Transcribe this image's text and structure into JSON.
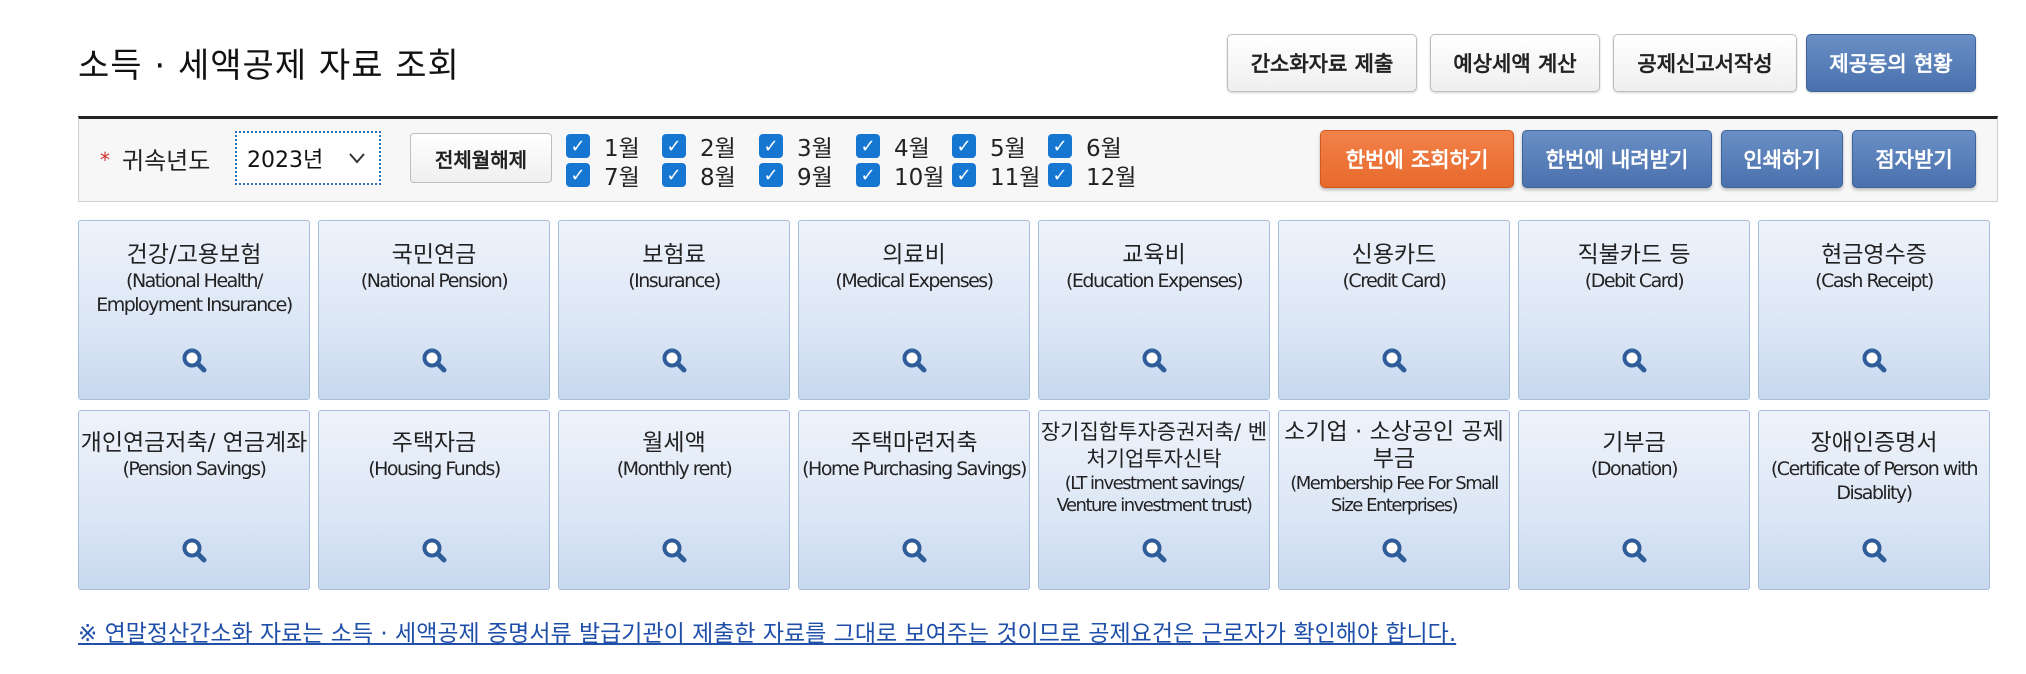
{
  "page": {
    "title": "소득 · 세액공제 자료 조회",
    "notice": "※ 연말정산간소화 자료는 소득 · 세액공제 증명서류 발급기관이 제출한 자료를 그대로 보여주는 것이므로 공제요건은 근로자가 확인해야 합니다."
  },
  "top_buttons": [
    {
      "label": "간소화자료 제출"
    },
    {
      "label": "예상세액 계산"
    },
    {
      "label": "공제신고서작성"
    },
    {
      "label": "제공동의 현황"
    }
  ],
  "search": {
    "required_mark": "*",
    "year_label": "귀속년도",
    "year_value": "2023년",
    "clear_months_label": "전체월해제",
    "months": [
      {
        "label": "1월",
        "checked": true
      },
      {
        "label": "2월",
        "checked": true
      },
      {
        "label": "3월",
        "checked": true
      },
      {
        "label": "4월",
        "checked": true
      },
      {
        "label": "5월",
        "checked": true
      },
      {
        "label": "6월",
        "checked": true
      },
      {
        "label": "7월",
        "checked": true
      },
      {
        "label": "8월",
        "checked": true
      },
      {
        "label": "9월",
        "checked": true
      },
      {
        "label": "10월",
        "checked": true
      },
      {
        "label": "11월",
        "checked": true
      },
      {
        "label": "12월",
        "checked": true
      }
    ],
    "check_mark": "✓",
    "action_buttons": [
      {
        "label": "한번에 조회하기"
      },
      {
        "label": "한번에 내려받기"
      },
      {
        "label": "인쇄하기"
      },
      {
        "label": "점자받기"
      }
    ]
  },
  "categories": [
    {
      "ko": "건강/고용보험",
      "en": "(National Health/ Employment Insurance)"
    },
    {
      "ko": "국민연금",
      "en": "(National Pension)"
    },
    {
      "ko": "보험료",
      "en": "(Insurance)"
    },
    {
      "ko": "의료비",
      "en": "(Medical Expenses)"
    },
    {
      "ko": "교육비",
      "en": "(Education Expenses)"
    },
    {
      "ko": "신용카드",
      "en": "(Credit Card)"
    },
    {
      "ko": "직불카드 등",
      "en": "(Debit Card)"
    },
    {
      "ko": "현금영수증",
      "en": "(Cash Receipt)"
    },
    {
      "ko": "개인연금저축/ 연금계좌",
      "en": "(Pension Savings)"
    },
    {
      "ko": "주택자금",
      "en": "(Housing Funds)"
    },
    {
      "ko": "월세액",
      "en": "(Monthly rent)"
    },
    {
      "ko": "주택마련저축",
      "en": "(Home Purchasing Savings)"
    },
    {
      "ko": "장기집합투자증권저축/ 벤처기업투자신탁",
      "en": "(LT investment savings/ Venture investment trust)"
    },
    {
      "ko": "소기업 · 소상공인 공제부금",
      "en": "(Membership Fee For Small Size Enterprises)"
    },
    {
      "ko": "기부금",
      "en": "(Donation)"
    },
    {
      "ko": "장애인증명서",
      "en": "(Certificate of Person with Disablity)"
    }
  ],
  "icons": {
    "tile_icon": "magnifier-icon",
    "select_icon": "chevron-down-icon",
    "check_icon": "checkbox-checked-icon"
  },
  "colors": {
    "primary_blue": "#4a71ad",
    "accent_orange": "#e8692c",
    "checkbox_blue": "#1677d2",
    "link_blue": "#1f4fa8",
    "required_red": "#d32f2f"
  }
}
